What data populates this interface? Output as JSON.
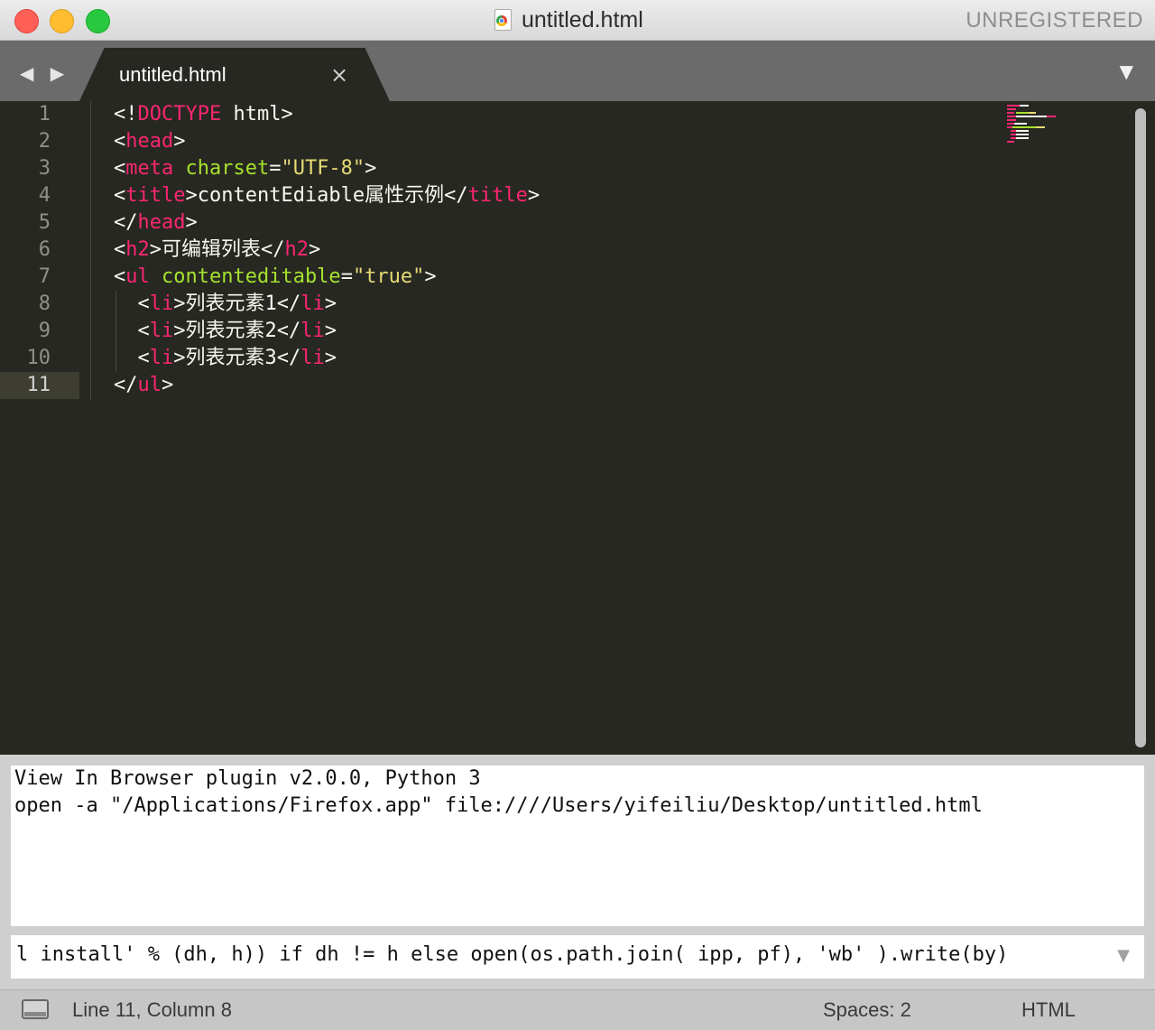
{
  "window": {
    "title": "untitled.html",
    "registration": "UNREGISTERED"
  },
  "tabbar": {
    "nav_arrows": "◀ ▶",
    "tab_label": "untitled.html",
    "tab_close": "×",
    "menu_arrow": "▼"
  },
  "editor": {
    "language": "HTML",
    "active_line": 11,
    "line_numbers": [
      "1",
      "2",
      "3",
      "4",
      "5",
      "6",
      "7",
      "8",
      "9",
      "10",
      "11"
    ],
    "lines": [
      "<!DOCTYPE html>",
      "<head>",
      "<meta charset=\"UTF-8\">",
      "<title>contentEdiable属性示例</title>",
      "</head>",
      "<h2>可编辑列表</h2>",
      "<ul contenteditable=\"true\">",
      "  <li>列表元素1</li>",
      "  <li>列表元素2</li>",
      "  <li>列表元素3</li>",
      "</ul>"
    ],
    "colors": {
      "background": "#272822",
      "tag": "#f92672",
      "attribute": "#a6e22e",
      "string": "#e6db74",
      "text": "#f8f8f2"
    }
  },
  "output": {
    "lines": [
      "View In Browser plugin v2.0.0, Python 3",
      "open -a \"/Applications/Firefox.app\" file:////Users/yifeiliu/Desktop/untitled.html"
    ]
  },
  "console": {
    "value": "l install' % (dh, h)) if dh != h else open(os.path.join( ipp, pf), 'wb' ).write(by)",
    "arrow": "▼"
  },
  "statusbar": {
    "position": "Line 11, Column 8",
    "spaces": "Spaces: 2",
    "syntax": "HTML"
  }
}
